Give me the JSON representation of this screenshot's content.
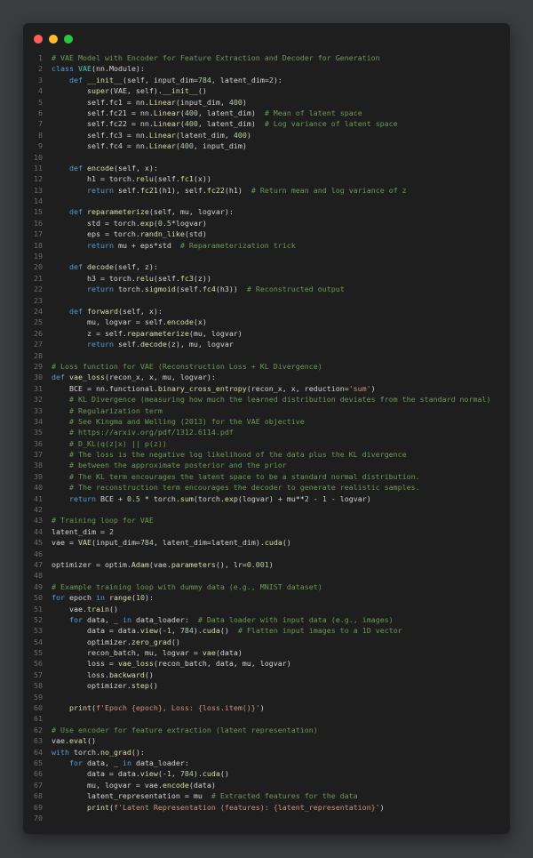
{
  "window": {
    "controls": [
      "close-icon",
      "minimize-icon",
      "maximize-icon"
    ],
    "colors": {
      "background": "#1e1e1e",
      "close": "#ff5f57",
      "minimize": "#febc2e",
      "maximize": "#28c840"
    }
  },
  "editor": {
    "language": "python",
    "lines": [
      "# VAE Model with Encoder for Feature Extraction and Decoder for Generation",
      "class VAE(nn.Module):",
      "    def __init__(self, input_dim=784, latent_dim=2):",
      "        super(VAE, self).__init__()",
      "        self.fc1 = nn.Linear(input_dim, 400)",
      "        self.fc21 = nn.Linear(400, latent_dim)  # Mean of latent space",
      "        self.fc22 = nn.Linear(400, latent_dim)  # Log variance of latent space",
      "        self.fc3 = nn.Linear(latent_dim, 400)",
      "        self.fc4 = nn.Linear(400, input_dim)",
      "",
      "    def encode(self, x):",
      "        h1 = torch.relu(self.fc1(x))",
      "        return self.fc21(h1), self.fc22(h1)  # Return mean and log variance of z",
      "",
      "    def reparameterize(self, mu, logvar):",
      "        std = torch.exp(0.5*logvar)",
      "        eps = torch.randn_like(std)",
      "        return mu + eps*std  # Reparameterization trick",
      "",
      "    def decode(self, z):",
      "        h3 = torch.relu(self.fc3(z))",
      "        return torch.sigmoid(self.fc4(h3))  # Reconstructed output",
      "",
      "    def forward(self, x):",
      "        mu, logvar = self.encode(x)",
      "        z = self.reparameterize(mu, logvar)",
      "        return self.decode(z), mu, logvar",
      "",
      "# Loss function for VAE (Reconstruction Loss + KL Divergence)",
      "def vae_loss(recon_x, x, mu, logvar):",
      "    BCE = nn.functional.binary_cross_entropy(recon_x, x, reduction='sum')",
      "    # KL Divergence (measuring how much the learned distribution deviates from the standard normal)",
      "    # Regularization term",
      "    # See Kingma and Welling (2013) for the VAE objective",
      "    # https://arxiv.org/pdf/1312.6114.pdf",
      "    # D_KL(q(z|x) || p(z))",
      "    # The loss is the negative log likelihood of the data plus the KL divergence",
      "    # between the approximate posterior and the prior",
      "    # The KL term encourages the latent space to be a standard normal distribution.",
      "    # The reconstruction term encourages the decoder to generate realistic samples.",
      "    return BCE + 0.5 * torch.sum(torch.exp(logvar) + mu**2 - 1 - logvar)",
      "",
      "# Training loop for VAE",
      "latent_dim = 2",
      "vae = VAE(input_dim=784, latent_dim=latent_dim).cuda()",
      "",
      "optimizer = optim.Adam(vae.parameters(), lr=0.001)",
      "",
      "# Example training loop with dummy data (e.g., MNIST dataset)",
      "for epoch in range(10):",
      "    vae.train()",
      "    for data, _ in data_loader:  # Data loader with input data (e.g., images)",
      "        data = data.view(-1, 784).cuda()  # Flatten input images to a 1D vector",
      "        optimizer.zero_grad()",
      "        recon_batch, mu, logvar = vae(data)",
      "        loss = vae_loss(recon_batch, data, mu, logvar)",
      "        loss.backward()",
      "        optimizer.step()",
      "",
      "    print(f'Epoch {epoch}, Loss: {loss.item()}')",
      "",
      "# Use encoder for feature extraction (latent representation)",
      "vae.eval()",
      "with torch.no_grad():",
      "    for data, _ in data_loader:",
      "        data = data.view(-1, 784).cuda()",
      "        mu, logvar = vae.encode(data)",
      "        latent_representation = mu  # Extracted features for the data",
      "        print(f'Latent Representation (features): {latent_representation}')",
      ""
    ]
  }
}
